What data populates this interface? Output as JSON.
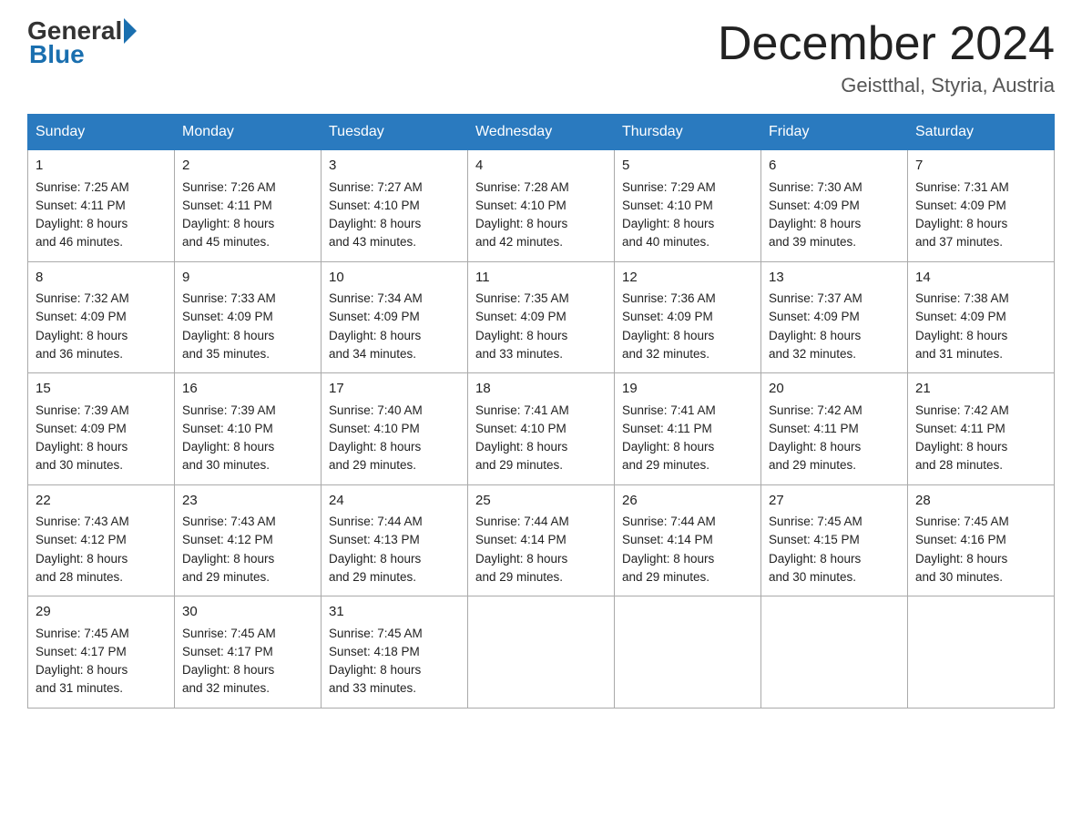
{
  "logo": {
    "general": "General",
    "blue": "Blue"
  },
  "title": "December 2024",
  "location": "Geistthal, Styria, Austria",
  "days_of_week": [
    "Sunday",
    "Monday",
    "Tuesday",
    "Wednesday",
    "Thursday",
    "Friday",
    "Saturday"
  ],
  "weeks": [
    [
      {
        "day": "1",
        "sunrise": "7:25 AM",
        "sunset": "4:11 PM",
        "daylight": "8 hours and 46 minutes."
      },
      {
        "day": "2",
        "sunrise": "7:26 AM",
        "sunset": "4:11 PM",
        "daylight": "8 hours and 45 minutes."
      },
      {
        "day": "3",
        "sunrise": "7:27 AM",
        "sunset": "4:10 PM",
        "daylight": "8 hours and 43 minutes."
      },
      {
        "day": "4",
        "sunrise": "7:28 AM",
        "sunset": "4:10 PM",
        "daylight": "8 hours and 42 minutes."
      },
      {
        "day": "5",
        "sunrise": "7:29 AM",
        "sunset": "4:10 PM",
        "daylight": "8 hours and 40 minutes."
      },
      {
        "day": "6",
        "sunrise": "7:30 AM",
        "sunset": "4:09 PM",
        "daylight": "8 hours and 39 minutes."
      },
      {
        "day": "7",
        "sunrise": "7:31 AM",
        "sunset": "4:09 PM",
        "daylight": "8 hours and 37 minutes."
      }
    ],
    [
      {
        "day": "8",
        "sunrise": "7:32 AM",
        "sunset": "4:09 PM",
        "daylight": "8 hours and 36 minutes."
      },
      {
        "day": "9",
        "sunrise": "7:33 AM",
        "sunset": "4:09 PM",
        "daylight": "8 hours and 35 minutes."
      },
      {
        "day": "10",
        "sunrise": "7:34 AM",
        "sunset": "4:09 PM",
        "daylight": "8 hours and 34 minutes."
      },
      {
        "day": "11",
        "sunrise": "7:35 AM",
        "sunset": "4:09 PM",
        "daylight": "8 hours and 33 minutes."
      },
      {
        "day": "12",
        "sunrise": "7:36 AM",
        "sunset": "4:09 PM",
        "daylight": "8 hours and 32 minutes."
      },
      {
        "day": "13",
        "sunrise": "7:37 AM",
        "sunset": "4:09 PM",
        "daylight": "8 hours and 32 minutes."
      },
      {
        "day": "14",
        "sunrise": "7:38 AM",
        "sunset": "4:09 PM",
        "daylight": "8 hours and 31 minutes."
      }
    ],
    [
      {
        "day": "15",
        "sunrise": "7:39 AM",
        "sunset": "4:09 PM",
        "daylight": "8 hours and 30 minutes."
      },
      {
        "day": "16",
        "sunrise": "7:39 AM",
        "sunset": "4:10 PM",
        "daylight": "8 hours and 30 minutes."
      },
      {
        "day": "17",
        "sunrise": "7:40 AM",
        "sunset": "4:10 PM",
        "daylight": "8 hours and 29 minutes."
      },
      {
        "day": "18",
        "sunrise": "7:41 AM",
        "sunset": "4:10 PM",
        "daylight": "8 hours and 29 minutes."
      },
      {
        "day": "19",
        "sunrise": "7:41 AM",
        "sunset": "4:11 PM",
        "daylight": "8 hours and 29 minutes."
      },
      {
        "day": "20",
        "sunrise": "7:42 AM",
        "sunset": "4:11 PM",
        "daylight": "8 hours and 29 minutes."
      },
      {
        "day": "21",
        "sunrise": "7:42 AM",
        "sunset": "4:11 PM",
        "daylight": "8 hours and 28 minutes."
      }
    ],
    [
      {
        "day": "22",
        "sunrise": "7:43 AM",
        "sunset": "4:12 PM",
        "daylight": "8 hours and 28 minutes."
      },
      {
        "day": "23",
        "sunrise": "7:43 AM",
        "sunset": "4:12 PM",
        "daylight": "8 hours and 29 minutes."
      },
      {
        "day": "24",
        "sunrise": "7:44 AM",
        "sunset": "4:13 PM",
        "daylight": "8 hours and 29 minutes."
      },
      {
        "day": "25",
        "sunrise": "7:44 AM",
        "sunset": "4:14 PM",
        "daylight": "8 hours and 29 minutes."
      },
      {
        "day": "26",
        "sunrise": "7:44 AM",
        "sunset": "4:14 PM",
        "daylight": "8 hours and 29 minutes."
      },
      {
        "day": "27",
        "sunrise": "7:45 AM",
        "sunset": "4:15 PM",
        "daylight": "8 hours and 30 minutes."
      },
      {
        "day": "28",
        "sunrise": "7:45 AM",
        "sunset": "4:16 PM",
        "daylight": "8 hours and 30 minutes."
      }
    ],
    [
      {
        "day": "29",
        "sunrise": "7:45 AM",
        "sunset": "4:17 PM",
        "daylight": "8 hours and 31 minutes."
      },
      {
        "day": "30",
        "sunrise": "7:45 AM",
        "sunset": "4:17 PM",
        "daylight": "8 hours and 32 minutes."
      },
      {
        "day": "31",
        "sunrise": "7:45 AM",
        "sunset": "4:18 PM",
        "daylight": "8 hours and 33 minutes."
      },
      null,
      null,
      null,
      null
    ]
  ],
  "labels": {
    "sunrise": "Sunrise:",
    "sunset": "Sunset:",
    "daylight": "Daylight:"
  }
}
